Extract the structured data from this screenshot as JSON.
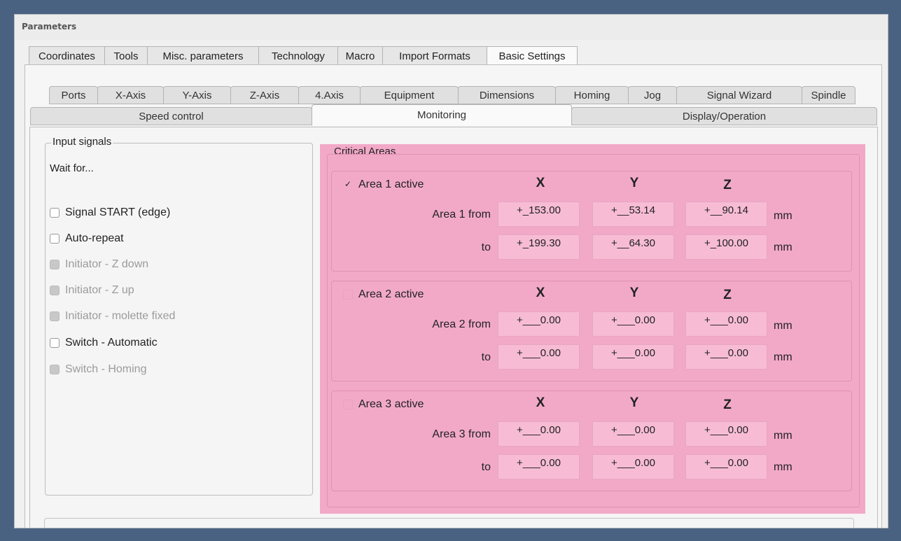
{
  "window": {
    "title": "Parameters"
  },
  "main_tabs": [
    {
      "label": "Coordinates"
    },
    {
      "label": "Tools"
    },
    {
      "label": "Misc. parameters"
    },
    {
      "label": "Technology"
    },
    {
      "label": "Macro"
    },
    {
      "label": "Import Formats"
    },
    {
      "label": "Basic Settings"
    }
  ],
  "sub_tabs_row1": [
    {
      "label": "Ports"
    },
    {
      "label": "X-Axis"
    },
    {
      "label": "Y-Axis"
    },
    {
      "label": "Z-Axis"
    },
    {
      "label": "4.Axis"
    },
    {
      "label": "Equipment"
    },
    {
      "label": "Dimensions"
    },
    {
      "label": "Homing"
    },
    {
      "label": "Jog"
    },
    {
      "label": "Signal Wizard"
    },
    {
      "label": "Spindle"
    }
  ],
  "sub_tabs_row2": [
    {
      "label": "Speed control"
    },
    {
      "label": "Monitoring"
    },
    {
      "label": "Display/Operation"
    }
  ],
  "input_signals": {
    "title": "Input signals",
    "wait_for": "Wait for...",
    "options": [
      {
        "label": "Signal START (edge)",
        "enabled": true,
        "checked": false
      },
      {
        "label": "Auto-repeat",
        "enabled": true,
        "checked": false
      },
      {
        "label": "Initiator - Z down",
        "enabled": false,
        "checked": false
      },
      {
        "label": "Initiator - Z up",
        "enabled": false,
        "checked": false
      },
      {
        "label": "Initiator - molette fixed",
        "enabled": false,
        "checked": false
      },
      {
        "label": "Switch - Automatic",
        "enabled": true,
        "checked": false
      },
      {
        "label": "Switch - Homing",
        "enabled": false,
        "checked": false
      }
    ]
  },
  "critical_areas": {
    "title": "Critical Areas",
    "axes": [
      "X",
      "Y",
      "Z"
    ],
    "unit": "mm",
    "to_label": "to",
    "areas": [
      {
        "active_label": "Area 1 active",
        "checked": true,
        "from_label": "Area 1 from",
        "from": [
          "+_153.00",
          "+__53.14",
          "+__90.14"
        ],
        "to": [
          "+_199.30",
          "+__64.30",
          "+_100.00"
        ]
      },
      {
        "active_label": "Area 2 active",
        "checked": false,
        "from_label": "Area 2 from",
        "from": [
          "+___0.00",
          "+___0.00",
          "+___0.00"
        ],
        "to": [
          "+___0.00",
          "+___0.00",
          "+___0.00"
        ]
      },
      {
        "active_label": "Area 3 active",
        "checked": false,
        "from_label": "Area 3 from",
        "from": [
          "+___0.00",
          "+___0.00",
          "+___0.00"
        ],
        "to": [
          "+___0.00",
          "+___0.00",
          "+___0.00"
        ]
      }
    ]
  },
  "colors": {
    "highlight": "#f2a9c8",
    "field": "#f7bcd4",
    "desktop": "#4a6282"
  }
}
